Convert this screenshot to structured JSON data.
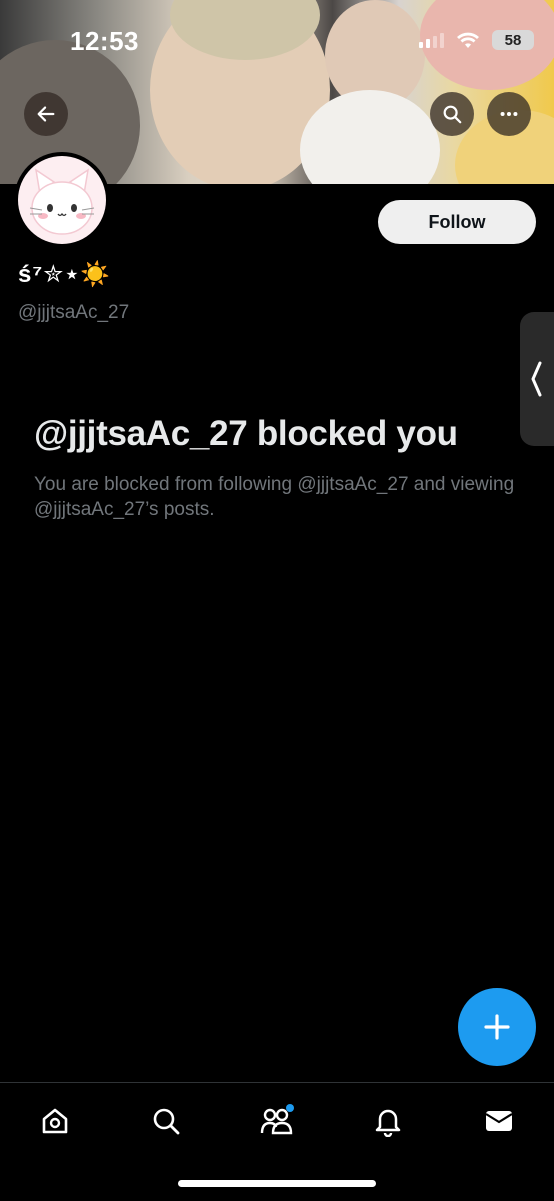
{
  "status_bar": {
    "time": "12:53",
    "battery": "58"
  },
  "header": {
    "back_icon": "arrow-left-icon",
    "search_icon": "search-icon",
    "more_icon": "more-horizontal-icon"
  },
  "profile": {
    "display_name": "ś⁷✮⋆☀️",
    "handle": "@jjjtsaAc_27",
    "follow_label": "Follow",
    "avatar_icon": "cat-face-icon"
  },
  "blocked": {
    "title": "@jjjtsaAc_27 blocked you",
    "description": "You are blocked from following @jjjtsaAc_27 and viewing @jjjtsaAc_27’s posts."
  },
  "fab": {
    "icon": "plus-icon"
  },
  "tabbar": {
    "items": [
      "home-icon",
      "search-icon",
      "communities-icon",
      "notifications-icon",
      "messages-icon"
    ]
  },
  "colors": {
    "accent": "#1d9bf0",
    "muted": "#71767b",
    "background": "#000000"
  }
}
